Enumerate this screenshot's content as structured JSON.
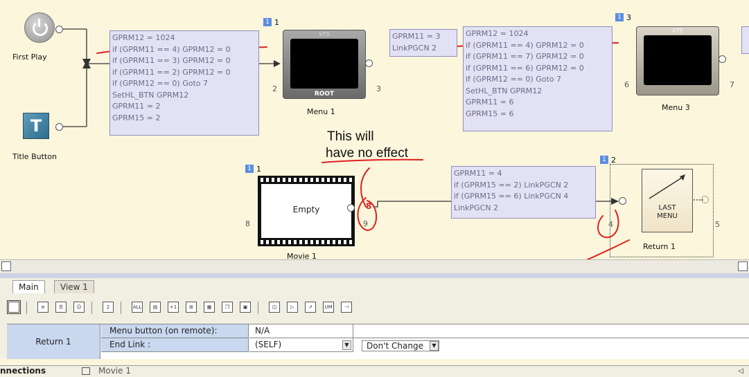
{
  "nodes": {
    "first_play": {
      "label": "First Play"
    },
    "title_button": {
      "label": "Title Button"
    },
    "menu1": {
      "label": "Menu 1",
      "badge": "1",
      "index": "1",
      "port_in": "2",
      "port_out": "3",
      "screen_top": "VTS",
      "screen_bottom": "ROOT"
    },
    "menu3": {
      "label": "Menu 3",
      "badge": "1",
      "index": "3",
      "port_in": "6",
      "port_out": "7",
      "screen_top": "VTS"
    },
    "movie1": {
      "label": "Movie 1",
      "badge": "1",
      "index": "1",
      "content": "Empty",
      "port_in": "8",
      "port_out": "9",
      "port_red": "8"
    },
    "return1": {
      "label": "Return 1",
      "badge": "1",
      "index": "2",
      "port_in": "4",
      "port_out": "5",
      "icon_text_1": "LAST",
      "icon_text_2": "MENU"
    }
  },
  "command_boxes": {
    "box1": [
      "GPRM12 = 1024",
      "if (GPRM11 == 4) GPRM12 = 0",
      "if (GPRM11 == 3) GPRM12 = 0",
      "if (GPRM11 == 2) GPRM12 = 0",
      "if (GPRM12 == 0) Goto 7",
      "SetHL_BTN GPRM12",
      "GPRM11 = 2",
      "GPRM15 = 2"
    ],
    "box2": [
      "GPRM11 = 3",
      "LinkPGCN 2"
    ],
    "box3": [
      "GPRM12 = 1024",
      "if (GPRM11 == 4) GPRM12 = 0",
      "if (GPRM11 == 7) GPRM12 = 0",
      "if (GPRM11 == 6) GPRM12 = 0",
      "if (GPRM12 == 0) Goto 7",
      "SetHL_BTN GPRM12",
      "GPRM11 = 6",
      "GPRM15 = 6"
    ],
    "box4": [
      "GPRM11 = 4",
      "if (GPRM15 == 2) LinkPGCN 2",
      "if (GPRM15 == 6) LinkPGCN 4",
      "LinkPGCN 2"
    ]
  },
  "annotations": {
    "note_line1": "This will",
    "note_line2": "have no effect",
    "equals_zero": "=0",
    "red_color": "#e02020"
  },
  "tabs": [
    "Main",
    "View 1"
  ],
  "toolbar": {
    "icons": [
      "monitor-icon",
      "list-icon",
      "list-alt-icon",
      "people-icon",
      "chapter-icon",
      "all-icon",
      "text-icon",
      "plus-one-icon",
      "grid-icon",
      "text-edit-icon",
      "copy-icon",
      "stack-icon",
      "compare-icon",
      "play-if-icon",
      "link-icon",
      "um-icon",
      "connector-icon"
    ],
    "labels": {
      "chapter": "2",
      "all": "ALL",
      "plus_one": "+1",
      "um": "UM"
    }
  },
  "properties": {
    "selected_name": "Return 1",
    "rows": [
      {
        "label": "Menu button (on remote):",
        "value": "N/A"
      },
      {
        "label": "End Link :",
        "value": "(SELF)",
        "dropdown": "Don't Change"
      }
    ]
  },
  "bottom_tabs": {
    "connections": "nnections",
    "movie": "Movie 1"
  },
  "colors": {
    "canvas": "#fbf6dc",
    "command_box": "#e3e2f4",
    "badge": "#5c8ee0",
    "panel": "#c9d8ee"
  }
}
